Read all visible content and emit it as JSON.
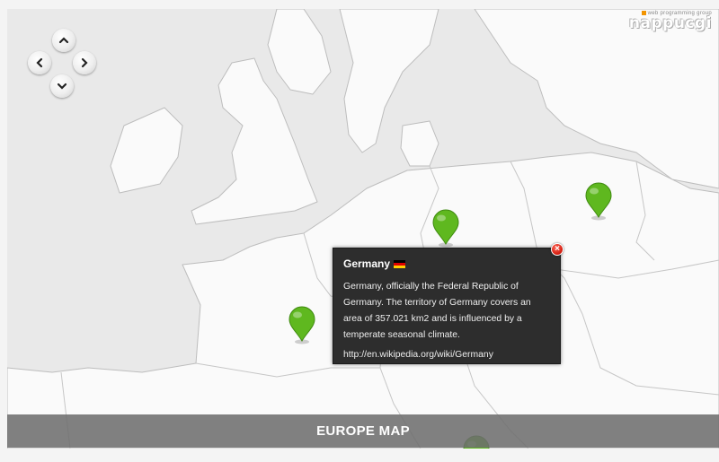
{
  "logo": {
    "tagline": "web programming group",
    "name": "nappucgi"
  },
  "navigation": {
    "up_icon": "chevron-up-icon",
    "down_icon": "chevron-down-icon",
    "left_icon": "chevron-left-icon",
    "right_icon": "chevron-right-icon"
  },
  "pins": [
    {
      "name": "map-pin",
      "color": "#5fb81f"
    },
    {
      "name": "map-pin",
      "color": "#5fb81f"
    },
    {
      "name": "map-pin",
      "color": "#5fb81f"
    },
    {
      "name": "map-pin",
      "color": "#5fb81f"
    }
  ],
  "tooltip": {
    "title": "Germany",
    "flag_colors": [
      "#000000",
      "#dd0000",
      "#ffce00"
    ],
    "description": "Germany, officially the Federal Republic of Germany. The territory of Germany covers an area of 357.021 km2 and is influenced by a temperate seasonal climate.",
    "link": "http://en.wikipedia.org/wiki/Germany",
    "close_label": "×"
  },
  "caption": "EUROPE MAP",
  "colors": {
    "land": "#fafafa",
    "sea": "#e9e9e9",
    "border": "#bdbdbd",
    "pin": "#5fb81f",
    "caption_bg": "#6e6e6e",
    "tooltip_bg": "#2d2d2d",
    "close": "#d21a0c"
  }
}
